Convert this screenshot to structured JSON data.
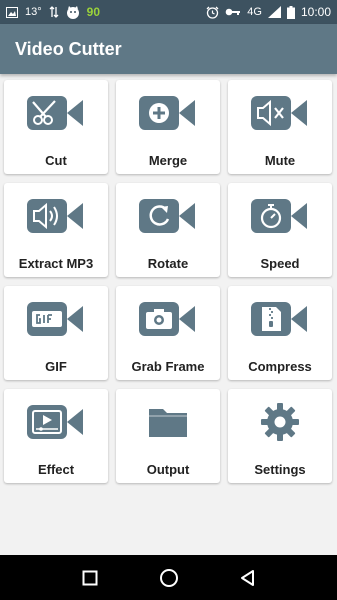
{
  "status_bar": {
    "temperature": "13°",
    "battery_percent": "90",
    "network": "4G",
    "network_sup": "4G",
    "time": "10:00",
    "icons": [
      "image-icon",
      "thermometer-icon",
      "data-transfer-icon",
      "cat-icon",
      "alarm-icon",
      "key-icon",
      "signal-icon",
      "battery-icon"
    ]
  },
  "app_bar": {
    "title": "Video Cutter"
  },
  "tools": [
    {
      "label": "Cut",
      "icon": "scissors-video-icon"
    },
    {
      "label": "Merge",
      "icon": "plus-video-icon"
    },
    {
      "label": "Mute",
      "icon": "mute-video-icon"
    },
    {
      "label": "Extract MP3",
      "icon": "speaker-video-icon"
    },
    {
      "label": "Rotate",
      "icon": "rotate-video-icon"
    },
    {
      "label": "Speed",
      "icon": "stopwatch-video-icon"
    },
    {
      "label": "GIF",
      "icon": "gif-video-icon"
    },
    {
      "label": "Grab Frame",
      "icon": "camera-video-icon"
    },
    {
      "label": "Compress",
      "icon": "zip-video-icon"
    },
    {
      "label": "Effect",
      "icon": "effect-video-icon"
    },
    {
      "label": "Output",
      "icon": "folder-icon"
    },
    {
      "label": "Settings",
      "icon": "gear-icon"
    }
  ],
  "nav_bar": {
    "buttons": [
      "recents-square-icon",
      "home-circle-icon",
      "back-triangle-icon"
    ]
  },
  "colors": {
    "status_bar": "#3d5260",
    "app_bar": "#5f7886",
    "icon": "#5f7886",
    "battery_text": "#9bd33a",
    "background": "#f2f2f2"
  }
}
